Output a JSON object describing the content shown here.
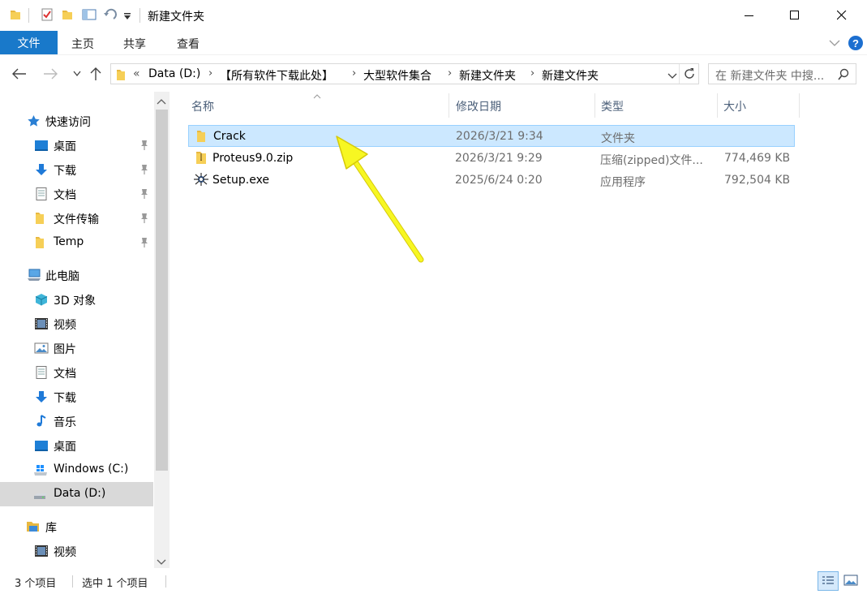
{
  "window": {
    "title": "新建文件夹"
  },
  "ribbon": {
    "tabs": [
      "文件",
      "主页",
      "共享",
      "查看"
    ]
  },
  "address": {
    "overflow": "«",
    "crumbs": [
      "Data (D:)",
      "【所有软件下载此处】",
      "大型软件集合",
      "新建文件夹",
      "新建文件夹"
    ],
    "search_placeholder": "在 新建文件夹 中搜..."
  },
  "nav": {
    "quick_access": "快速访问",
    "quick_items": [
      "桌面",
      "下载",
      "文档",
      "文件传输",
      "Temp"
    ],
    "this_pc": "此电脑",
    "pc_items": [
      "3D 对象",
      "视频",
      "图片",
      "文档",
      "下载",
      "音乐",
      "桌面",
      "Windows (C:)",
      "Data (D:)"
    ],
    "library": "库",
    "library_items": [
      "视频"
    ]
  },
  "columns": {
    "name": "名称",
    "date": "修改日期",
    "type": "类型",
    "size": "大小"
  },
  "files": [
    {
      "name": "Crack",
      "date": "2026/3/21 9:34",
      "type": "文件夹",
      "size": "",
      "icon": "folder-icon",
      "selected": true
    },
    {
      "name": "Proteus9.0.zip",
      "date": "2026/3/21 9:29",
      "type": "压缩(zipped)文件...",
      "size": "774,469 KB",
      "icon": "zip-icon",
      "selected": false
    },
    {
      "name": "Setup.exe",
      "date": "2025/6/24 0:20",
      "type": "应用程序",
      "size": "792,504 KB",
      "icon": "setup-exe-icon",
      "selected": false
    }
  ],
  "status": {
    "count": "3 个项目",
    "selection": "选中 1 个项目"
  },
  "colors": {
    "accent": "#1979ca",
    "selection_bg": "#cce8ff",
    "selection_border": "#99d1ff",
    "folder": "#f2c94c",
    "arrow": "#f7f722"
  }
}
